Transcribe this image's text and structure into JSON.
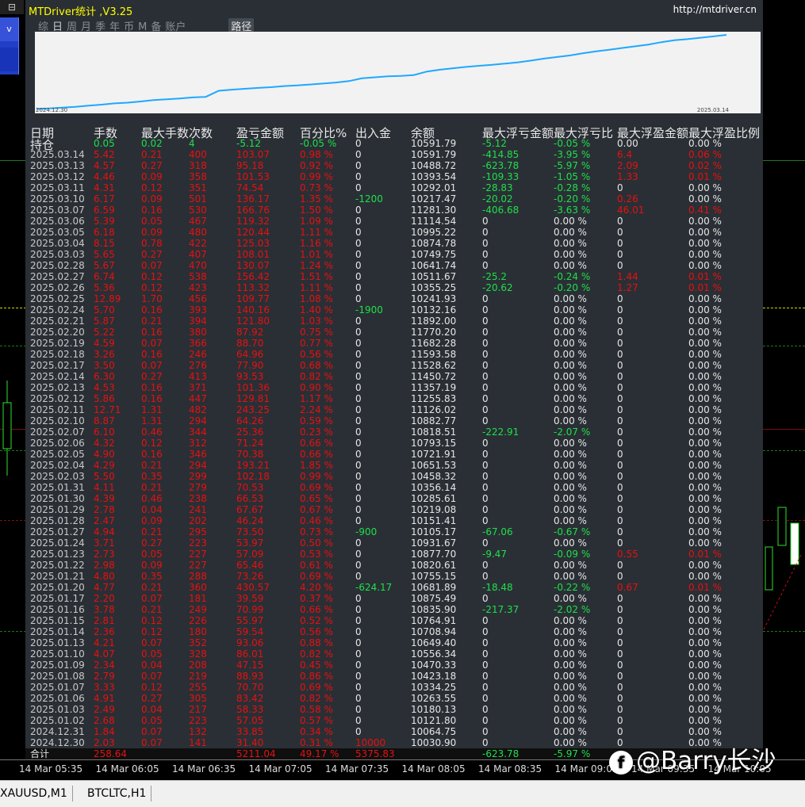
{
  "window": {
    "title": "MTDriver统计 ,V3.25",
    "url": "http://mtdriver.cn",
    "corner_icon": "window-restore-icon",
    "left_button": "v"
  },
  "tabs": [
    "综",
    "日",
    "周",
    "月",
    "季",
    "年",
    "币",
    "M",
    "备",
    "账户"
  ],
  "active_tab": "日",
  "path_button": "路径",
  "graph": {
    "start_date": "2024.12.30",
    "end_date": "2025.03.14",
    "line_color": "#1ea8ff"
  },
  "headers": [
    "日期",
    "手数",
    "最大手数",
    "次数",
    "盈亏金额",
    "百分比%",
    "出入金",
    "余额",
    "最大浮亏金额",
    "最大浮亏比",
    "最大浮盈金额",
    "最大浮盈比例"
  ],
  "position_label": "持仓",
  "position_row": {
    "lots": "0.05",
    "max_lots": "0.02",
    "count": "4",
    "pnl": "-5.12",
    "pct": "-0.05 %",
    "flow": "0",
    "balance": "10591.79",
    "max_float_loss": "-5.12",
    "max_float_loss_pct": "-0.05 %",
    "max_float_profit": "0.00",
    "max_float_profit_pct": "0.00 %"
  },
  "rows": [
    [
      "2025.03.14",
      "5.42",
      "0.21",
      "400",
      "103.07",
      "0.98 %",
      "0",
      "10591.79",
      "-414.85",
      "-3.95 %",
      "6.4",
      "0.06 %"
    ],
    [
      "2025.03.13",
      "4.57",
      "0.27",
      "318",
      "95.18",
      "0.92 %",
      "0",
      "10488.72",
      "-623.78",
      "-5.97 %",
      "2.09",
      "0.02 %"
    ],
    [
      "2025.03.12",
      "4.46",
      "0.09",
      "358",
      "101.53",
      "0.99 %",
      "0",
      "10393.54",
      "-109.33",
      "-1.05 %",
      "1.33",
      "0.01 %"
    ],
    [
      "2025.03.11",
      "4.31",
      "0.12",
      "351",
      "74.54",
      "0.73 %",
      "0",
      "10292.01",
      "-28.83",
      "-0.28 %",
      "0",
      "0.00 %"
    ],
    [
      "2025.03.10",
      "6.17",
      "0.09",
      "501",
      "136.17",
      "1.35 %",
      "-1200",
      "10217.47",
      "-20.02",
      "-0.20 %",
      "0.26",
      "0.00 %"
    ],
    [
      "2025.03.07",
      "6.59",
      "0.16",
      "530",
      "166.76",
      "1.50 %",
      "0",
      "11281.30",
      "-406.68",
      "-3.63 %",
      "46.01",
      "0.41 %"
    ],
    [
      "2025.03.06",
      "5.39",
      "0.05",
      "467",
      "119.32",
      "1.09 %",
      "0",
      "11114.54",
      "0",
      "0.00 %",
      "0",
      "0.00 %"
    ],
    [
      "2025.03.05",
      "6.18",
      "0.09",
      "480",
      "120.44",
      "1.11 %",
      "0",
      "10995.22",
      "0",
      "0.00 %",
      "0",
      "0.00 %"
    ],
    [
      "2025.03.04",
      "8.15",
      "0.78",
      "422",
      "125.03",
      "1.16 %",
      "0",
      "10874.78",
      "0",
      "0.00 %",
      "0",
      "0.00 %"
    ],
    [
      "2025.03.03",
      "5.65",
      "0.27",
      "407",
      "108.01",
      "1.01 %",
      "0",
      "10749.75",
      "0",
      "0.00 %",
      "0",
      "0.00 %"
    ],
    [
      "2025.02.28",
      "5.67",
      "0.07",
      "470",
      "130.07",
      "1.24 %",
      "0",
      "10641.74",
      "0",
      "0.00 %",
      "0",
      "0.00 %"
    ],
    [
      "2025.02.27",
      "6.74",
      "0.12",
      "538",
      "156.42",
      "1.51 %",
      "0",
      "10511.67",
      "-25.2",
      "-0.24 %",
      "1.44",
      "0.01 %"
    ],
    [
      "2025.02.26",
      "5.36",
      "0.12",
      "423",
      "113.32",
      "1.11 %",
      "0",
      "10355.25",
      "-20.62",
      "-0.20 %",
      "1.27",
      "0.01 %"
    ],
    [
      "2025.02.25",
      "12.89",
      "1.70",
      "456",
      "109.77",
      "1.08 %",
      "0",
      "10241.93",
      "0",
      "0.00 %",
      "0",
      "0.00 %"
    ],
    [
      "2025.02.24",
      "5.70",
      "0.16",
      "393",
      "140.16",
      "1.40 %",
      "-1900",
      "10132.16",
      "0",
      "0.00 %",
      "0",
      "0.00 %"
    ],
    [
      "2025.02.21",
      "5.87",
      "0.21",
      "394",
      "121.80",
      "1.03 %",
      "0",
      "11892.00",
      "0",
      "0.00 %",
      "0",
      "0.00 %"
    ],
    [
      "2025.02.20",
      "5.22",
      "0.16",
      "380",
      "87.92",
      "0.75 %",
      "0",
      "11770.20",
      "0",
      "0.00 %",
      "0",
      "0.00 %"
    ],
    [
      "2025.02.19",
      "4.59",
      "0.07",
      "366",
      "88.70",
      "0.77 %",
      "0",
      "11682.28",
      "0",
      "0.00 %",
      "0",
      "0.00 %"
    ],
    [
      "2025.02.18",
      "3.26",
      "0.16",
      "246",
      "64.96",
      "0.56 %",
      "0",
      "11593.58",
      "0",
      "0.00 %",
      "0",
      "0.00 %"
    ],
    [
      "2025.02.17",
      "3.50",
      "0.07",
      "276",
      "77.90",
      "0.68 %",
      "0",
      "11528.62",
      "0",
      "0.00 %",
      "0",
      "0.00 %"
    ],
    [
      "2025.02.14",
      "6.30",
      "0.27",
      "413",
      "93.53",
      "0.82 %",
      "0",
      "11450.72",
      "0",
      "0.00 %",
      "0",
      "0.00 %"
    ],
    [
      "2025.02.13",
      "4.53",
      "0.16",
      "371",
      "101.36",
      "0.90 %",
      "0",
      "11357.19",
      "0",
      "0.00 %",
      "0",
      "0.00 %"
    ],
    [
      "2025.02.12",
      "5.86",
      "0.16",
      "447",
      "129.81",
      "1.17 %",
      "0",
      "11255.83",
      "0",
      "0.00 %",
      "0",
      "0.00 %"
    ],
    [
      "2025.02.11",
      "12.71",
      "1.31",
      "482",
      "243.25",
      "2.24 %",
      "0",
      "11126.02",
      "0",
      "0.00 %",
      "0",
      "0.00 %"
    ],
    [
      "2025.02.10",
      "8.87",
      "1.31",
      "294",
      "64.26",
      "0.59 %",
      "0",
      "10882.77",
      "0",
      "0.00 %",
      "0",
      "0.00 %"
    ],
    [
      "2025.02.07",
      "6.10",
      "0.46",
      "344",
      "25.36",
      "0.23 %",
      "0",
      "10818.51",
      "-222.91",
      "-2.07 %",
      "0",
      "0.00 %"
    ],
    [
      "2025.02.06",
      "4.32",
      "0.12",
      "312",
      "71.24",
      "0.66 %",
      "0",
      "10793.15",
      "0",
      "0.00 %",
      "0",
      "0.00 %"
    ],
    [
      "2025.02.05",
      "4.90",
      "0.16",
      "346",
      "70.38",
      "0.66 %",
      "0",
      "10721.91",
      "0",
      "0.00 %",
      "0",
      "0.00 %"
    ],
    [
      "2025.02.04",
      "4.29",
      "0.21",
      "294",
      "193.21",
      "1.85 %",
      "0",
      "10651.53",
      "0",
      "0.00 %",
      "0",
      "0.00 %"
    ],
    [
      "2025.02.03",
      "5.50",
      "0.35",
      "299",
      "102.18",
      "0.99 %",
      "0",
      "10458.32",
      "0",
      "0.00 %",
      "0",
      "0.00 %"
    ],
    [
      "2025.01.31",
      "4.11",
      "0.21",
      "279",
      "70.53",
      "0.69 %",
      "0",
      "10356.14",
      "0",
      "0.00 %",
      "0",
      "0.00 %"
    ],
    [
      "2025.01.30",
      "4.39",
      "0.46",
      "238",
      "66.53",
      "0.65 %",
      "0",
      "10285.61",
      "0",
      "0.00 %",
      "0",
      "0.00 %"
    ],
    [
      "2025.01.29",
      "2.78",
      "0.04",
      "241",
      "67.67",
      "0.67 %",
      "0",
      "10219.08",
      "0",
      "0.00 %",
      "0",
      "0.00 %"
    ],
    [
      "2025.01.28",
      "2.47",
      "0.09",
      "202",
      "46.24",
      "0.46 %",
      "0",
      "10151.41",
      "0",
      "0.00 %",
      "0",
      "0.00 %"
    ],
    [
      "2025.01.27",
      "4.94",
      "0.21",
      "295",
      "73.50",
      "0.73 %",
      "-900",
      "10105.17",
      "-67.06",
      "-0.67 %",
      "0",
      "0.00 %"
    ],
    [
      "2025.01.24",
      "3.71",
      "0.27",
      "223",
      "53.97",
      "0.50 %",
      "0",
      "10931.67",
      "0",
      "0.00 %",
      "0",
      "0.00 %"
    ],
    [
      "2025.01.23",
      "2.73",
      "0.05",
      "227",
      "57.09",
      "0.53 %",
      "0",
      "10877.70",
      "-9.47",
      "-0.09 %",
      "0.55",
      "0.01 %"
    ],
    [
      "2025.01.22",
      "2.98",
      "0.09",
      "227",
      "65.46",
      "0.61 %",
      "0",
      "10820.61",
      "0",
      "0.00 %",
      "0",
      "0.00 %"
    ],
    [
      "2025.01.21",
      "4.80",
      "0.35",
      "288",
      "73.26",
      "0.69 %",
      "0",
      "10755.15",
      "0",
      "0.00 %",
      "0",
      "0.00 %"
    ],
    [
      "2025.01.20",
      "4.77",
      "0.21",
      "360",
      "430.57",
      "4.20 %",
      "-624.17",
      "10681.89",
      "-18.48",
      "-0.22 %",
      "0.67",
      "0.01 %"
    ],
    [
      "2025.01.17",
      "2.20",
      "0.07",
      "181",
      "39.59",
      "0.37 %",
      "0",
      "10875.49",
      "0",
      "0.00 %",
      "0",
      "0.00 %"
    ],
    [
      "2025.01.16",
      "3.78",
      "0.21",
      "249",
      "70.99",
      "0.66 %",
      "0",
      "10835.90",
      "-217.37",
      "-2.02 %",
      "0",
      "0.00 %"
    ],
    [
      "2025.01.15",
      "2.81",
      "0.12",
      "226",
      "55.97",
      "0.52 %",
      "0",
      "10764.91",
      "0",
      "0.00 %",
      "0",
      "0.00 %"
    ],
    [
      "2025.01.14",
      "2.36",
      "0.12",
      "180",
      "59.54",
      "0.56 %",
      "0",
      "10708.94",
      "0",
      "0.00 %",
      "0",
      "0.00 %"
    ],
    [
      "2025.01.13",
      "4.21",
      "0.07",
      "352",
      "93.06",
      "0.88 %",
      "0",
      "10649.40",
      "0",
      "0.00 %",
      "0",
      "0.00 %"
    ],
    [
      "2025.01.10",
      "4.07",
      "0.05",
      "328",
      "86.01",
      "0.82 %",
      "0",
      "10556.34",
      "0",
      "0.00 %",
      "0",
      "0.00 %"
    ],
    [
      "2025.01.09",
      "2.34",
      "0.04",
      "208",
      "47.15",
      "0.45 %",
      "0",
      "10470.33",
      "0",
      "0.00 %",
      "0",
      "0.00 %"
    ],
    [
      "2025.01.08",
      "2.79",
      "0.07",
      "219",
      "88.93",
      "0.86 %",
      "0",
      "10423.18",
      "0",
      "0.00 %",
      "0",
      "0.00 %"
    ],
    [
      "2025.01.07",
      "3.33",
      "0.12",
      "255",
      "70.70",
      "0.69 %",
      "0",
      "10334.25",
      "0",
      "0.00 %",
      "0",
      "0.00 %"
    ],
    [
      "2025.01.06",
      "4.91",
      "0.27",
      "305",
      "83.42",
      "0.82 %",
      "0",
      "10263.55",
      "0",
      "0.00 %",
      "0",
      "0.00 %"
    ],
    [
      "2025.01.03",
      "2.49",
      "0.04",
      "217",
      "58.33",
      "0.58 %",
      "0",
      "10180.13",
      "0",
      "0.00 %",
      "0",
      "0.00 %"
    ],
    [
      "2025.01.02",
      "2.68",
      "0.05",
      "223",
      "57.05",
      "0.57 %",
      "0",
      "10121.80",
      "0",
      "0.00 %",
      "0",
      "0.00 %"
    ],
    [
      "2024.12.31",
      "1.84",
      "0.07",
      "132",
      "33.85",
      "0.34 %",
      "0",
      "10064.75",
      "0",
      "0.00 %",
      "0",
      "0.00 %"
    ],
    [
      "2024.12.30",
      "2.03",
      "0.07",
      "141",
      "31.40",
      "0.31 %",
      "10000",
      "10030.90",
      "0",
      "0.00 %",
      "0",
      "0.00 %"
    ]
  ],
  "total": {
    "label": "合计",
    "lots": "258.64",
    "pnl": "5211.04",
    "pct": "49.17 %",
    "flow": "5375.83",
    "max_float_loss": "-623.78",
    "max_float_loss_pct": "-5.97 %"
  },
  "time_axis": [
    "14 Mar 05:35",
    "14 Mar 06:05",
    "14 Mar 06:35",
    "14 Mar 07:05",
    "14 Mar 07:35",
    "14 Mar 08:05",
    "14 Mar 08:35",
    "14 Mar 09:05",
    "14 Mar 09:35",
    "14 Mar 10:05"
  ],
  "chart_tabs": [
    "XAUUSD,M1",
    "BTCLTC,H1"
  ],
  "watermark": "@Barry长沙",
  "watermark_icon": "platform-logo-icon"
}
